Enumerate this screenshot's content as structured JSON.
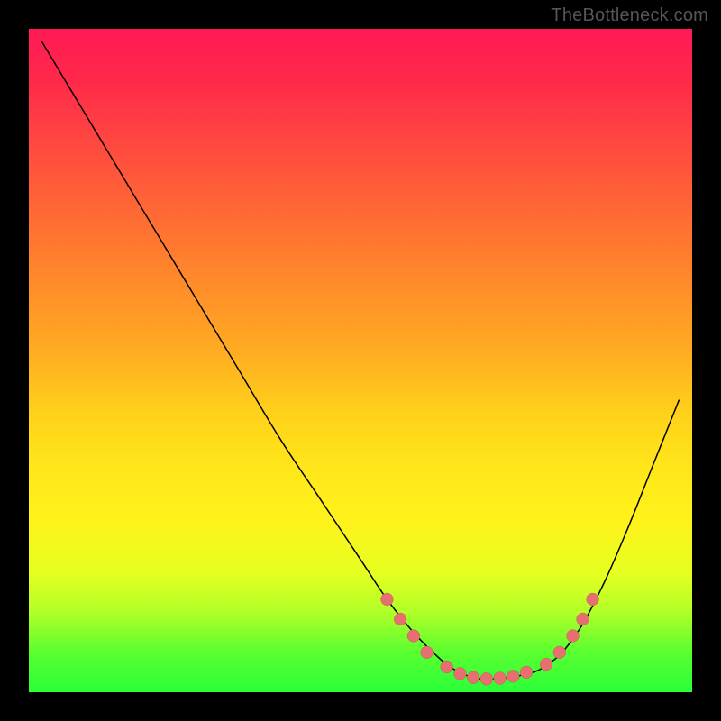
{
  "watermark": "TheBottleneck.com",
  "chart_data": {
    "type": "line",
    "title": "",
    "xlabel": "",
    "ylabel": "",
    "xlim": [
      0,
      100
    ],
    "ylim": [
      0,
      100
    ],
    "grid": false,
    "legend": false,
    "series": [
      {
        "name": "bottleneck-curve",
        "x": [
          2,
          8,
          14,
          20,
          26,
          32,
          38,
          44,
          50,
          54,
          58,
          62,
          64,
          66,
          68,
          70,
          74,
          78,
          82,
          86,
          90,
          94,
          98
        ],
        "y": [
          98,
          88,
          78,
          68,
          58,
          48,
          38,
          29,
          20,
          14,
          9,
          5,
          3.5,
          2.5,
          2,
          2,
          2.5,
          4,
          8,
          15,
          24,
          34,
          44
        ]
      }
    ],
    "markers": [
      {
        "x": 54,
        "y": 14
      },
      {
        "x": 56,
        "y": 11
      },
      {
        "x": 58,
        "y": 8.5
      },
      {
        "x": 60,
        "y": 6
      },
      {
        "x": 63,
        "y": 3.8
      },
      {
        "x": 65,
        "y": 2.8
      },
      {
        "x": 67,
        "y": 2.2
      },
      {
        "x": 69,
        "y": 2
      },
      {
        "x": 71,
        "y": 2.1
      },
      {
        "x": 73,
        "y": 2.4
      },
      {
        "x": 75,
        "y": 3
      },
      {
        "x": 78,
        "y": 4.2
      },
      {
        "x": 80,
        "y": 6
      },
      {
        "x": 82,
        "y": 8.5
      },
      {
        "x": 83.5,
        "y": 11
      },
      {
        "x": 85,
        "y": 14
      }
    ]
  }
}
